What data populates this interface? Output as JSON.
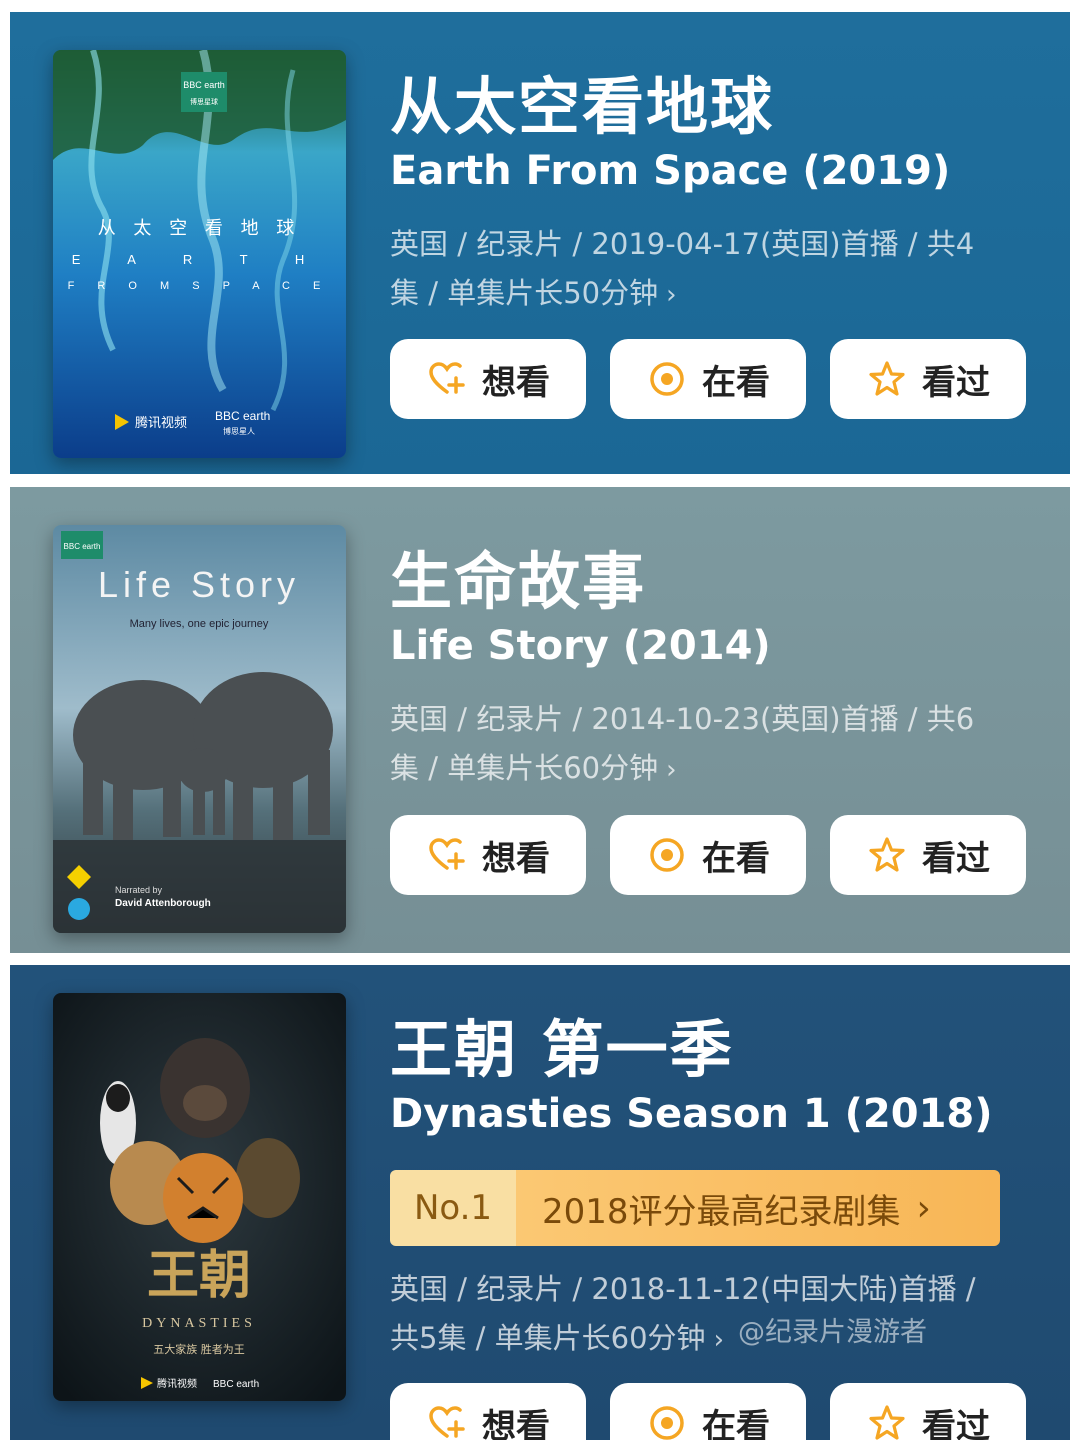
{
  "items": [
    {
      "title_zh": "从太空看地球",
      "title_en": "Earth From Space (2019)",
      "meta_line1": "英国 / 纪录片 / 2019-04-17(英国)首播 / 共4",
      "meta_line2": "集 / 单集片长50分钟",
      "poster": {
        "brand_top": "BBC earth",
        "brand_top_sub": "博思星球",
        "title_zh_chars": "从 太 空 看 地 球",
        "title_en_line1": "E A R T H",
        "title_en_line2": "F R O M   S P A C E",
        "logo_left": "腾讯视频",
        "logo_right": "BBC earth",
        "logo_right_sub": "博思星人"
      }
    },
    {
      "title_zh": "生命故事",
      "title_en": "Life Story (2014)",
      "meta_line1": "英国 / 纪录片 / 2014-10-23(英国)首播 / 共6",
      "meta_line2": "集 / 单集片长60分钟",
      "poster": {
        "brand_top": "BBC earth",
        "title": "Life Story",
        "tagline": "Many lives, one epic journey",
        "narrated_by": "Narrated by",
        "narrator": "David Attenborough"
      }
    },
    {
      "title_zh": "王朝 第一季",
      "title_en": "Dynasties Season 1 (2018)",
      "rank_no": "No.1",
      "rank_text": "2018评分最高纪录剧集",
      "meta_line1": "英国 / 纪录片 / 2018-11-12(中国大陆)首播 /",
      "meta_line2": "共5集 / 单集片长60分钟",
      "poster": {
        "title_zh": "王朝",
        "title_en": "DYNASTIES",
        "subtitle": "五大家族  胜者为王",
        "logo_left": "腾讯视频",
        "logo_right": "BBC earth"
      }
    }
  ],
  "buttons": {
    "want": "想看",
    "watching": "在看",
    "watched": "看过"
  },
  "watermark": "@纪录片漫游者",
  "colors": {
    "accent_orange": "#f5a623",
    "card1_bg": "#1f6e9c",
    "card2_bg": "#7d9aa0",
    "card3_bg": "#22527a"
  },
  "icons": {
    "want": "heart-plus-icon",
    "watching": "circle-dot-icon",
    "watched": "star-icon",
    "chevron": "chevron-right-icon"
  }
}
